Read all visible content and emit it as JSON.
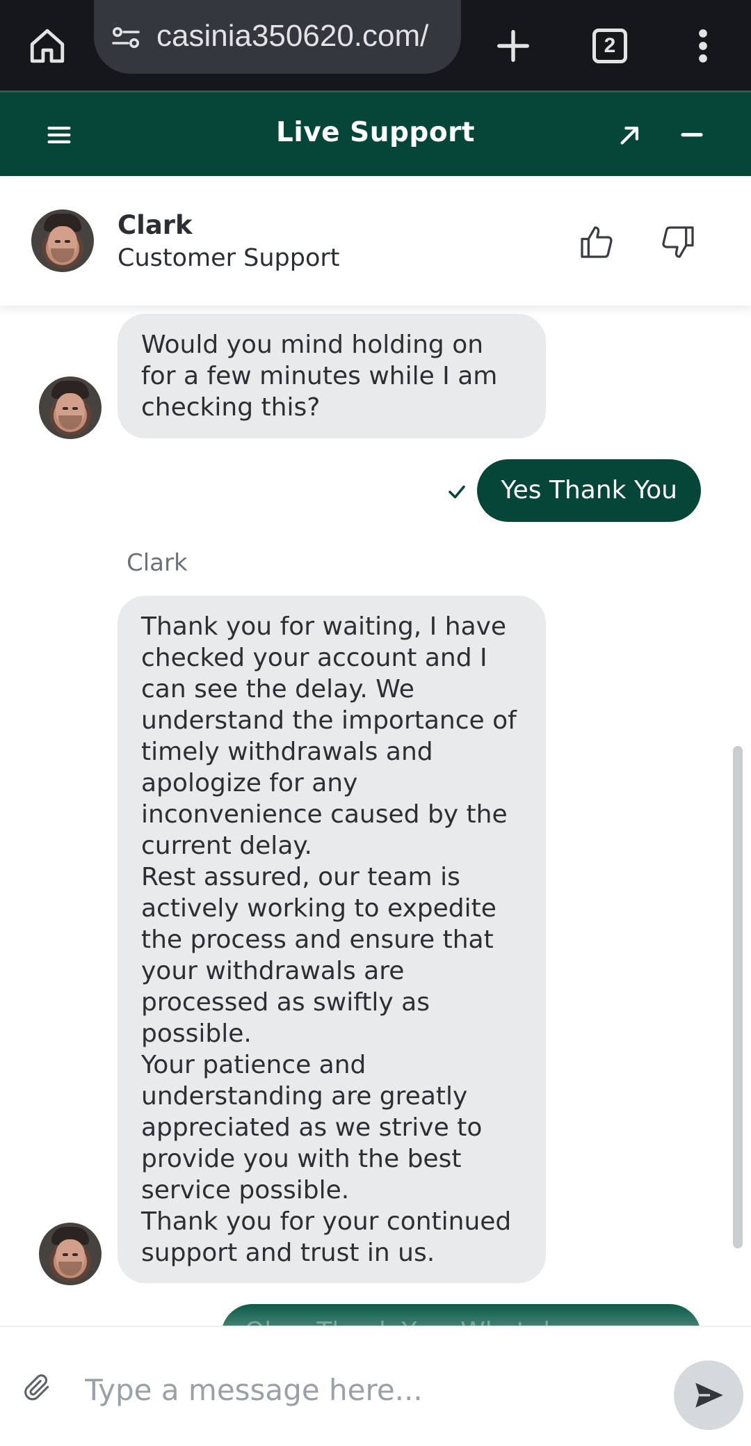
{
  "browser": {
    "url": "casinia350620.com/",
    "tab_count": "2",
    "icons": [
      "home-icon",
      "site-settings-icon",
      "new-tab-icon",
      "tab-switcher-icon",
      "more-menu-icon"
    ]
  },
  "header": {
    "title": "Live Support",
    "accent_color": "#054638"
  },
  "agent": {
    "name": "Clark",
    "role": "Customer Support"
  },
  "messages": [
    {
      "from": "agent",
      "text": "Would you mind holding on for a few minutes while I am checking this?"
    },
    {
      "from": "user",
      "text": "Yes Thank You",
      "status": "sent"
    },
    {
      "from": "agent",
      "sender": "Clark",
      "text": "Thank you for waiting, I have checked your account and I can see the delay. We understand the importance of timely withdrawals and apologize for any inconvenience caused by the current delay.\nRest assured, our team is actively working to expedite the process and ensure that your withdrawals are processed as swiftly as possible.\nYour patience and understanding are greatly appreciated as we strive to provide you with the best service possible.\nThank you for your continued support and trust in us."
    },
    {
      "from": "user",
      "text": "Okay Thank You, What do",
      "partial": true
    }
  ],
  "composer": {
    "placeholder": "Type a message here...",
    "value": ""
  }
}
